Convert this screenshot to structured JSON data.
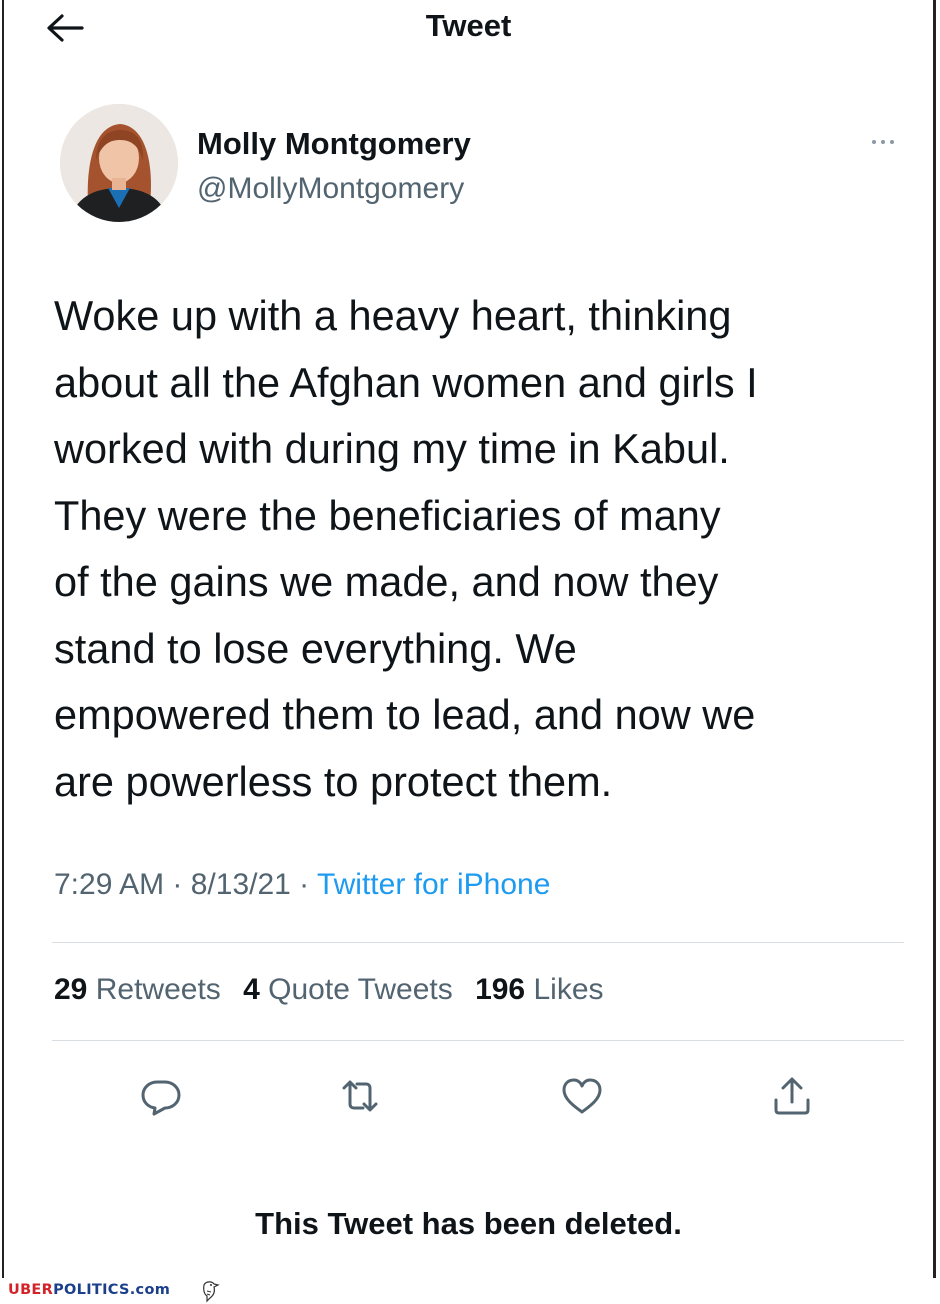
{
  "header": {
    "title": "Tweet",
    "back_icon": "arrow-left-icon"
  },
  "author": {
    "name": "Molly Montgomery",
    "handle": "@MollyMontgomery",
    "more_icon": "more-horizontal-icon"
  },
  "tweet": {
    "text": "Woke up with a heavy heart, thinking\nabout all the Afghan women and girls I\nworked with during my time in Kabul.\nThey were the beneficiaries of many\nof the gains we made, and now they\nstand to lose everything. We\nempowered them to lead, and now we\nare powerless to protect them."
  },
  "meta": {
    "time": "7:29 AM",
    "sep1": " · ",
    "date": "8/13/21",
    "sep2": " · ",
    "source": "Twitter for iPhone"
  },
  "stats": {
    "retweets_count": "29",
    "retweets_label": "Retweets",
    "quotes_count": "4",
    "quotes_label": "Quote Tweets",
    "likes_count": "196",
    "likes_label": "Likes"
  },
  "actions": [
    {
      "icon": "reply-icon"
    },
    {
      "icon": "retweet-icon"
    },
    {
      "icon": "heart-icon"
    },
    {
      "icon": "share-icon"
    }
  ],
  "notice": "This Tweet has been deleted.",
  "watermark": {
    "brand_part1": "UBER",
    "brand_part2": "POLITICS.com"
  },
  "colors": {
    "text": "#0f1419",
    "secondary": "#536471",
    "link": "#1d9bf0",
    "divider": "#d8dde1",
    "brand_red": "#d2232a",
    "brand_blue": "#1b3f8b"
  }
}
